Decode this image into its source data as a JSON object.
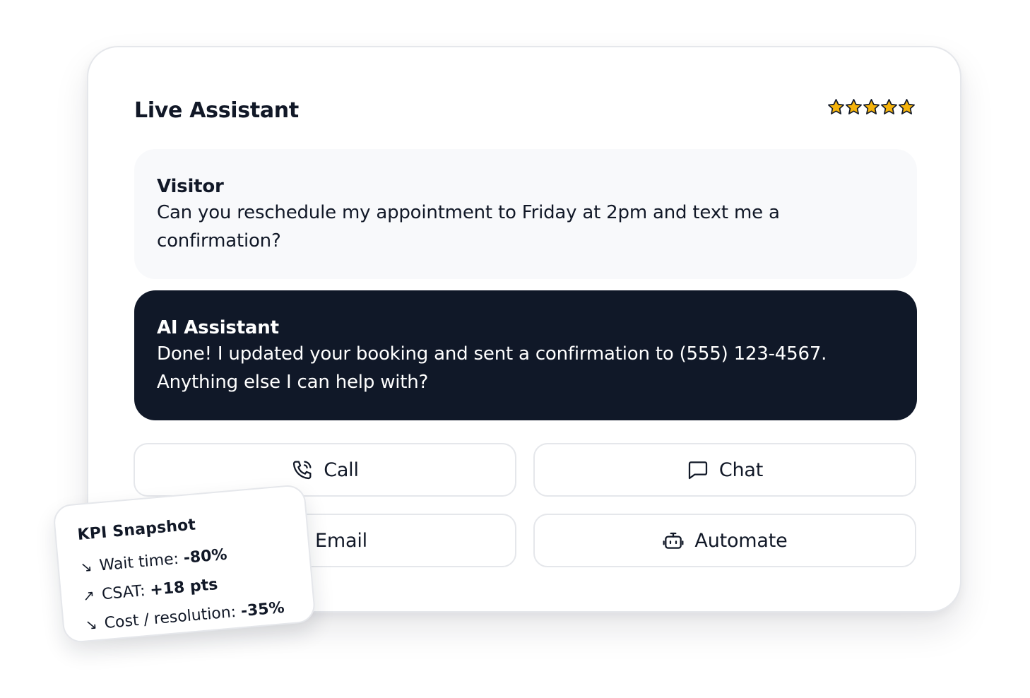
{
  "card": {
    "title": "Live Assistant",
    "rating": {
      "value": 5,
      "max": 5,
      "star_color": "#f5b30b"
    }
  },
  "messages": [
    {
      "sender": "Visitor",
      "text": "Can you reschedule my appointment to Friday at 2pm and text me a confirmation?"
    },
    {
      "sender": "AI Assistant",
      "text": "Done! I updated your booking and sent a confirmation to (555) 123-4567. Anything else I can help with?"
    }
  ],
  "actions": {
    "call": {
      "label": "Call",
      "icon": "phone-icon"
    },
    "chat": {
      "label": "Chat",
      "icon": "chat-bubble-icon"
    },
    "email": {
      "label": "Email",
      "icon": "mail-icon"
    },
    "automate": {
      "label": "Automate",
      "icon": "robot-icon"
    }
  },
  "kpi": {
    "title": "KPI Snapshot",
    "items": [
      {
        "arrow": "↘",
        "label": "Wait time:",
        "value": "-80%"
      },
      {
        "arrow": "↗",
        "label": "CSAT:",
        "value": "+18 pts"
      },
      {
        "arrow": "↘",
        "label": "Cost / resolution:",
        "value": "-35%"
      }
    ]
  },
  "colors": {
    "dark_bubble": "#101828",
    "light_bubble": "#f8f9fb",
    "border": "#e5e7eb",
    "text": "#111827"
  }
}
